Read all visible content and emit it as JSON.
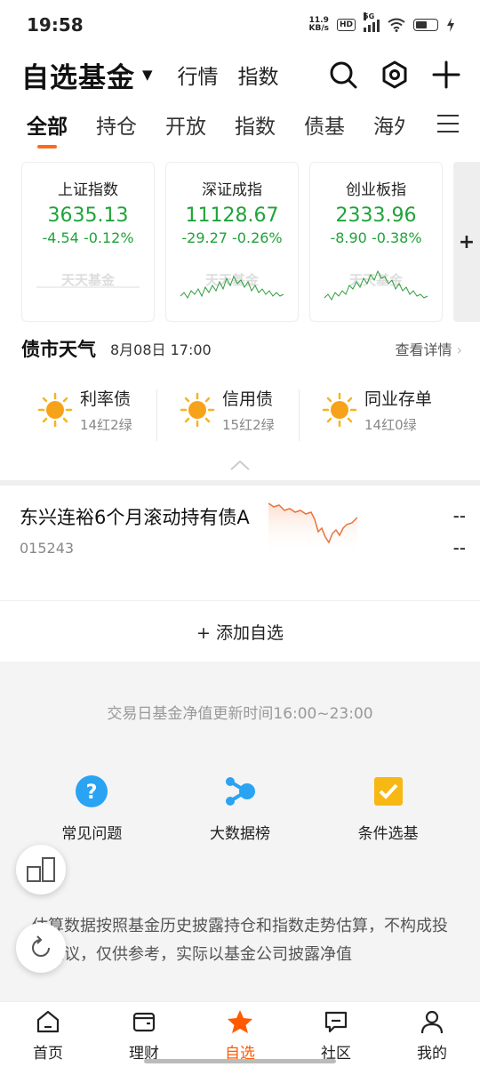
{
  "status": {
    "time": "19:58",
    "net_speed": "11.9",
    "net_unit": "KB/s",
    "hd": "HD",
    "signal": "5G"
  },
  "header": {
    "title": "自选基金",
    "nav1": "行情",
    "nav2": "指数"
  },
  "tabs": [
    "全部",
    "持仓",
    "开放",
    "指数",
    "债基",
    "海外"
  ],
  "indices": [
    {
      "name": "上证指数",
      "value": "3635.13",
      "change": "-4.54 -0.12%"
    },
    {
      "name": "深证成指",
      "value": "11128.67",
      "change": "-29.27 -0.26%"
    },
    {
      "name": "创业板指",
      "value": "2333.96",
      "change": "-8.90 -0.38%"
    }
  ],
  "watermark": "天天基金",
  "add_card": "+",
  "weather": {
    "title": "债市天气",
    "date": "8月08日 17:00",
    "more": "查看详情",
    "items": [
      {
        "label": "利率债",
        "sub": "14红2绿"
      },
      {
        "label": "信用债",
        "sub": "15红2绿"
      },
      {
        "label": "同业存单",
        "sub": "14红0绿"
      }
    ]
  },
  "fund": {
    "name": "东兴连裕6个月滚动持有债A",
    "code": "015243",
    "v1": "--",
    "v2": "--"
  },
  "add_watch": "+ 添加自选",
  "note": "交易日基金净值更新时间16:00~23:00",
  "tools": [
    {
      "label": "常见问题"
    },
    {
      "label": "大数据榜"
    },
    {
      "label": "条件选基"
    }
  ],
  "disclaimer": "估算数据按照基金历史披露持仓和指数走势估算，不构成投资建议，仅供参考，实际以基金公司披露净值",
  "bottom_nav": [
    {
      "label": "首页"
    },
    {
      "label": "理财"
    },
    {
      "label": "自选"
    },
    {
      "label": "社区"
    },
    {
      "label": "我的"
    }
  ],
  "colors": {
    "accent": "#ff6a1a",
    "down": "#1fa33a"
  }
}
